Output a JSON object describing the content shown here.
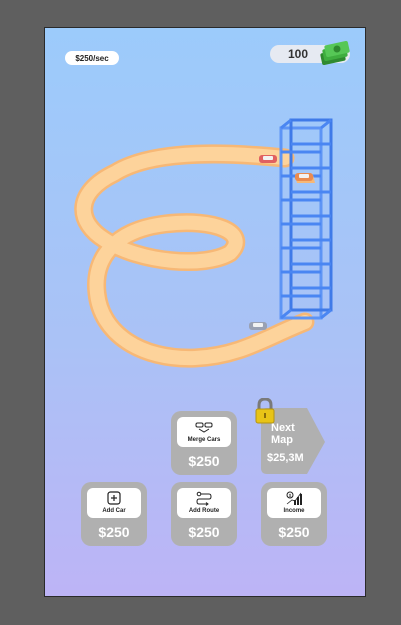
{
  "hud": {
    "rate_label": "$250/sec",
    "money_value": "100",
    "cash_icon": "cash-stack-icon"
  },
  "upgrades": {
    "merge": {
      "name": "Merge Cars",
      "price": "$250",
      "icon": "merge-cars-icon"
    },
    "add_car": {
      "name": "Add Car",
      "price": "$250",
      "icon": "plus-square-icon"
    },
    "add_route": {
      "name": "Add Route",
      "price": "$250",
      "icon": "route-icon"
    },
    "income": {
      "name": "Income",
      "price": "$250",
      "icon": "income-chart-icon"
    }
  },
  "next_map": {
    "title": "Next\nMap",
    "price": "$25,3M",
    "locked": true,
    "icon": "padlock-icon"
  },
  "colors": {
    "track": "#fcc98a",
    "tower": "#4a86f2",
    "button": "#b0b0b0",
    "lock": "#e8c417"
  }
}
